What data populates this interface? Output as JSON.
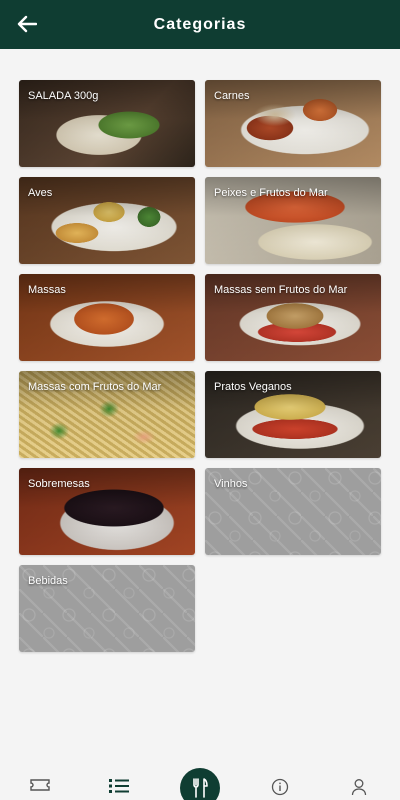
{
  "header": {
    "title": "Categorias",
    "back_icon": "arrow-left-icon"
  },
  "categories": [
    {
      "label": "SALADA 300g"
    },
    {
      "label": "Carnes"
    },
    {
      "label": "Aves"
    },
    {
      "label": "Peixes e Frutos do Mar"
    },
    {
      "label": "Massas"
    },
    {
      "label": "Massas sem Frutos do Mar"
    },
    {
      "label": "Massas com Frutos do Mar"
    },
    {
      "label": "Pratos Veganos"
    },
    {
      "label": "Sobremesas"
    },
    {
      "label": "Vinhos"
    },
    {
      "label": "Bebidas"
    }
  ],
  "bottom_nav": {
    "items": [
      "ticket-icon",
      "list-icon",
      "cutlery-icon",
      "info-icon",
      "user-icon"
    ],
    "active": "list-icon",
    "accent": "#0f3d32"
  }
}
